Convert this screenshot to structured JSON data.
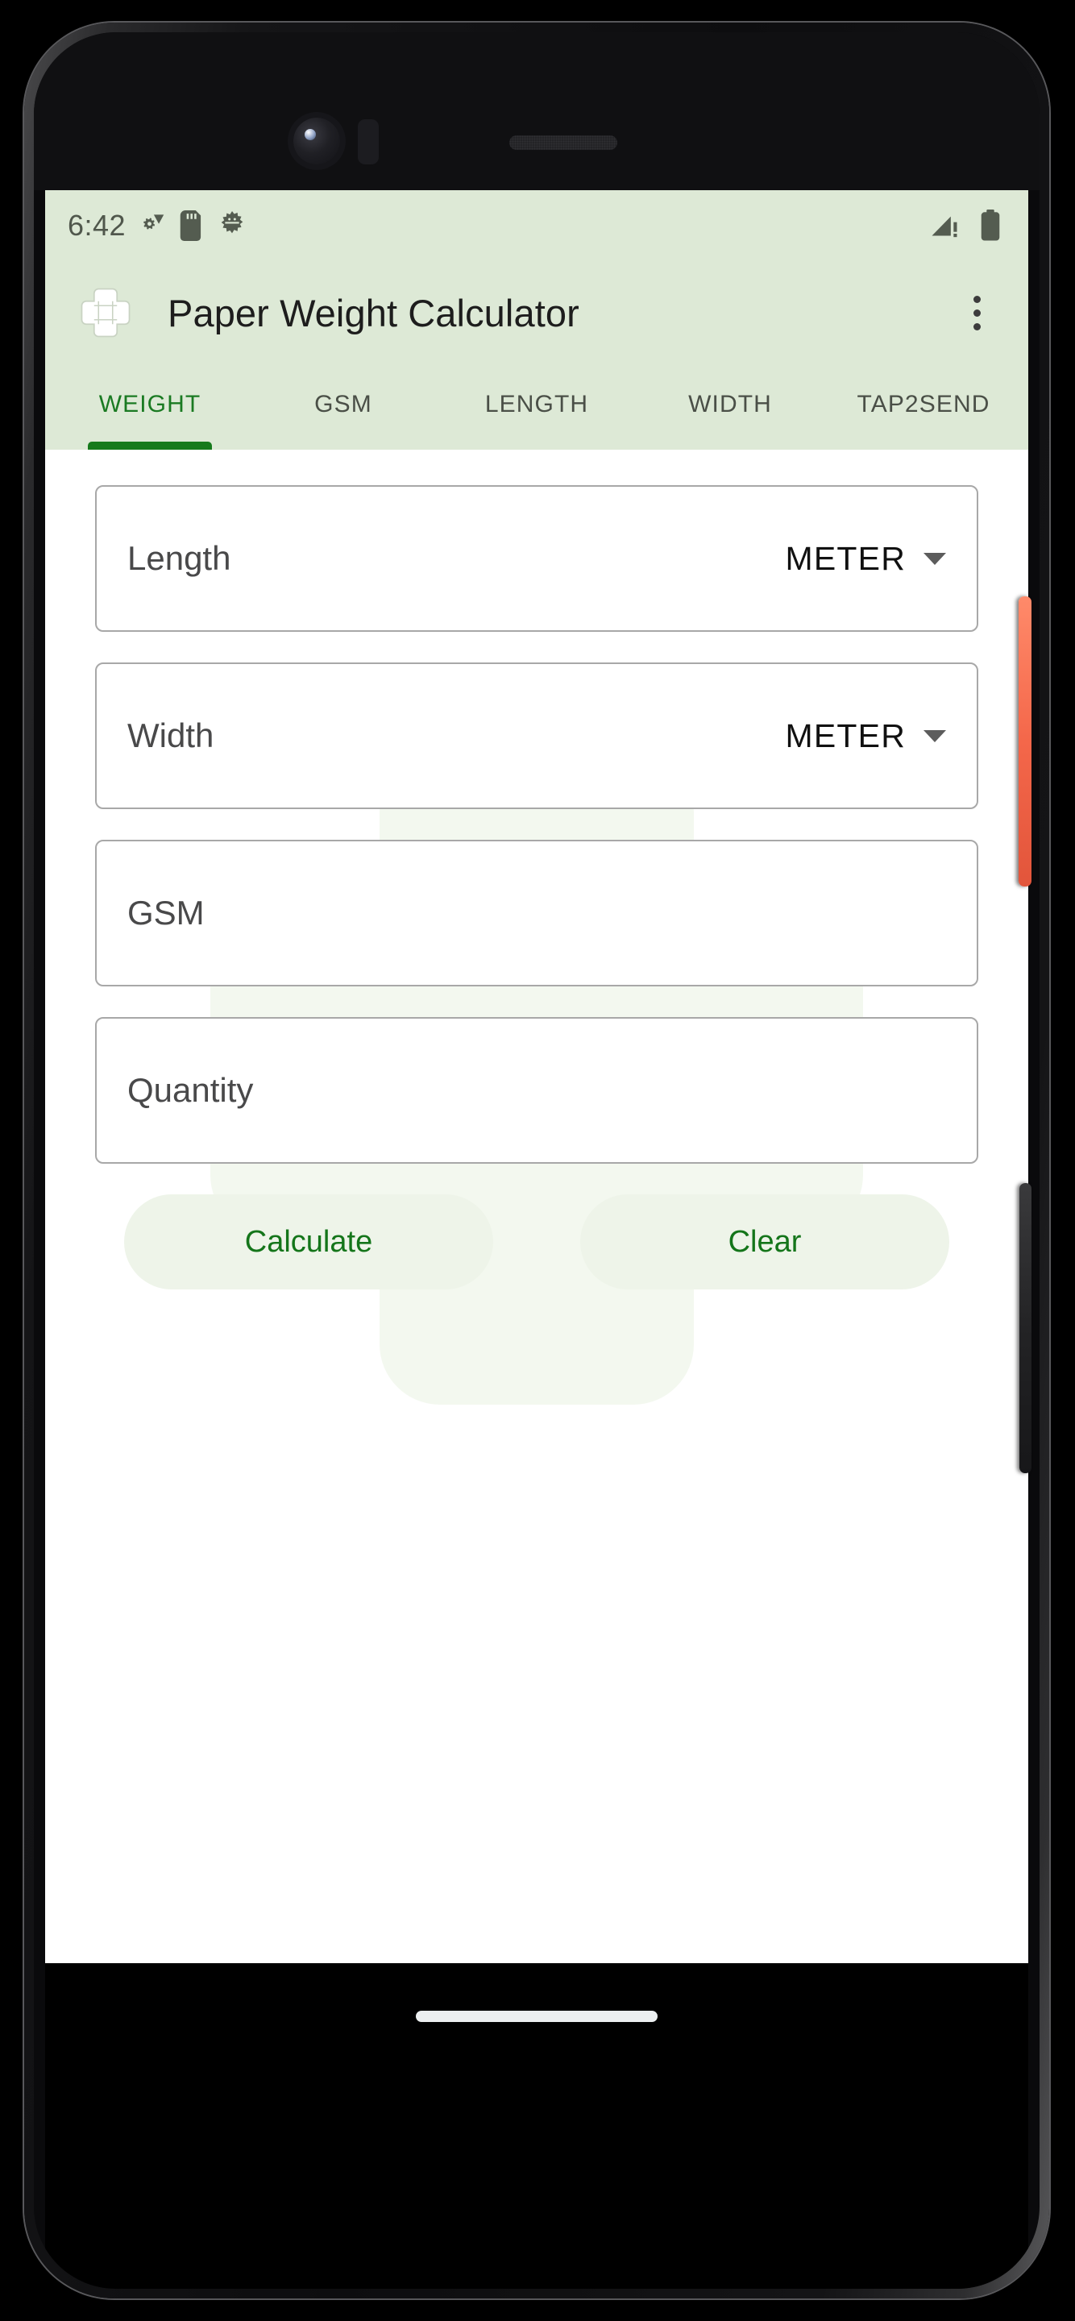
{
  "device": {
    "hardware": {
      "front_camera": "front-camera",
      "proximity_sensor": "proximity-sensor",
      "earpiece": "earpiece-speaker",
      "power_button": "power-button",
      "volume_button": "volume-rocker"
    }
  },
  "status_bar": {
    "time": "6:42",
    "background_color": "#dde9d6",
    "icon_color": "#545c50",
    "left_icons": [
      "settings-sync-icon",
      "sd-card-icon",
      "android-debug-icon"
    ],
    "right_icons": [
      "cellular-signal-no-sim-icon",
      "battery-full-icon"
    ]
  },
  "app_bar": {
    "logo_icon": "paper-cross-logo-icon",
    "title": "Paper Weight Calculator",
    "overflow_menu_icon": "more-vertical-icon",
    "background_color": "#dde9d6",
    "title_color": "#1d1d1d"
  },
  "tabs": {
    "active_index": 0,
    "accent_color": "#167a1c",
    "inactive_color": "#4a4f47",
    "items": [
      {
        "label": "WEIGHT"
      },
      {
        "label": "GSM"
      },
      {
        "label": "LENGTH"
      },
      {
        "label": "WIDTH"
      },
      {
        "label": "TAP2SEND"
      }
    ]
  },
  "form": {
    "fields": [
      {
        "label": "Length",
        "value": "",
        "placeholder": "Length",
        "has_unit": true,
        "unit": "METER",
        "unit_caret_icon": "chevron-down-icon"
      },
      {
        "label": "Width",
        "value": "",
        "placeholder": "Width",
        "has_unit": true,
        "unit": "METER",
        "unit_caret_icon": "chevron-down-icon"
      },
      {
        "label": "GSM",
        "value": "",
        "placeholder": "GSM",
        "has_unit": false,
        "unit": "",
        "unit_caret_icon": ""
      },
      {
        "label": "Quantity",
        "value": "",
        "placeholder": "Quantity",
        "has_unit": false,
        "unit": "",
        "unit_caret_icon": ""
      }
    ],
    "buttons": {
      "calculate_label": "Calculate",
      "clear_label": "Clear",
      "button_bg": "#eef4e9",
      "button_text_color": "#14751a"
    },
    "watermark_icon": "paper-cross-watermark-icon"
  },
  "navigation_bar": {
    "gesture_pill": "home-gesture-pill"
  }
}
